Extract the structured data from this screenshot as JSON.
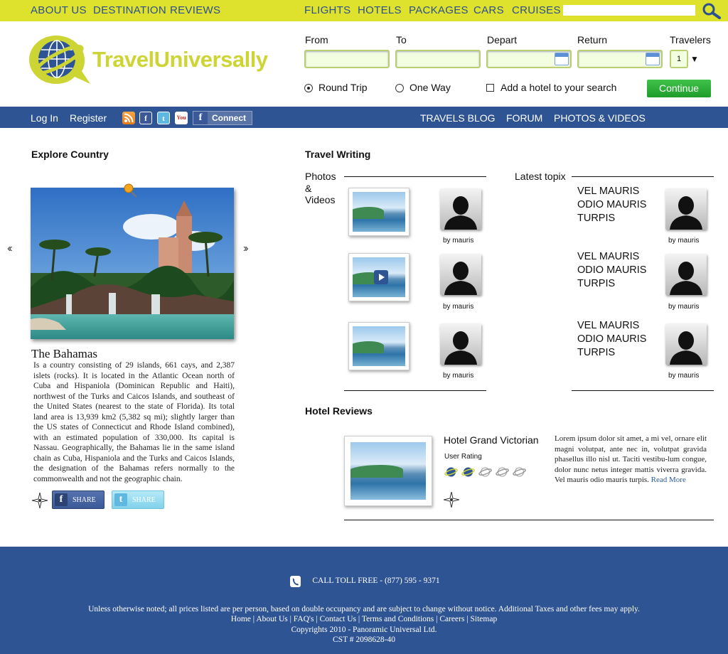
{
  "top_nav": {
    "about": "ABOUT US",
    "destination": "DESTINATION",
    "reviews": "REVIEWS",
    "flights": "FLIGHTS",
    "hotels": "HOTELS",
    "packages": "PACKAGES",
    "cars": "CARS",
    "cruises": "CRUISES",
    "search_value": "",
    "search_icon": "search-icon"
  },
  "logo": {
    "text": "TravelUniversally"
  },
  "booking": {
    "from_label": "From",
    "to_label": "To",
    "depart_label": "Depart",
    "return_label": "Return",
    "travelers_label": "Travelers",
    "travelers_value": "1",
    "round_trip_label": "Round Trip",
    "one_way_label": "One Way",
    "hotel_label": "Add a hotel to your search",
    "continue_label": "Continue",
    "trip_type": "Round Trip"
  },
  "user_nav": {
    "login": "Log In",
    "register": "Register",
    "connect": "Connect",
    "social_icons": [
      "rss-icon",
      "facebook-icon",
      "twitter-icon",
      "youtube-icon"
    ],
    "blog": "TRAVELS BLOG",
    "forum": "FORUM",
    "photos_videos": "PHOTOS & VIDEOS"
  },
  "explore": {
    "heading": "Explore Country",
    "prev": "‹‹",
    "next": "››",
    "country_name": "The Bahamas",
    "description": "Is a country consisting of 29 islands, 661 cays, and 2,387 islets (rocks). It is located in the Atlantic Ocean north of Cuba and Hispaniola (Dominican Republic and Haiti), northwest of the Turks and Caicos Islands, and southeast of the United States (nearest to the state of Florida). Its total land area is 13,939 km2 (5,382 sq mi); slightly larger than the US states of Connecticut and Rhode Island combined), with an estimated population of 330,000. Its capital is Nassau. Geographically, the Bahamas lie in the same island chain as Cuba, Hispaniola and the Turks and Caicos Islands, the designation of the Bahamas refers normally to the commonwealth and not the geographic chain.",
    "share_fb": "SHARE",
    "share_tw": "SHARE"
  },
  "travel_writing": {
    "heading": "Travel Writing",
    "photos_label_1": "Photos",
    "photos_label_2": "&",
    "photos_label_3": "Videos",
    "latest_label": "Latest topix",
    "media_items": [
      {
        "byline": "by mauris",
        "is_video": false
      },
      {
        "byline": "by mauris",
        "is_video": true
      },
      {
        "byline": "by mauris",
        "is_video": false
      }
    ],
    "topics": [
      {
        "title": "VEL MAURIS ODIO MAURIS TURPIS",
        "byline": "by mauris"
      },
      {
        "title": "VEL MAURIS ODIO MAURIS TURPIS",
        "byline": "by mauris"
      },
      {
        "title": "VEL MAURIS ODIO MAURIS TURPIS",
        "byline": "by mauris"
      }
    ]
  },
  "hotel_reviews": {
    "heading": "Hotel Reviews",
    "hotel_name": "Hotel Grand Victorian",
    "rating_label": "User Rating",
    "rating": 2,
    "rating_max": 5,
    "description": "Lorem ipsum dolor sit amet, a mi vel, ornare elit magni volutpat, ante nec in, volutpat gravida phasellus illo nisl ut. Taciti vestibu-lum congue, dolor nunc netus integer mattis viverra gravida. Vel mauris odio mauris turpis.",
    "read_more": "Read More"
  },
  "footer": {
    "phone": "CALL TOLL FREE - (877) 595 - 9371",
    "notice": "Unless otherwise noted; all prices listed are per person, based on double occupancy and are subject to change without notice. Additional Taxes and other fees may apply.",
    "links": [
      "Home",
      "About Us",
      "FAQ's",
      "Contact Us",
      "Terms and Conditions",
      "Careers",
      "Sitemap"
    ],
    "copyright": "Copyrights 2010 - Panoramic Universal Ltd.",
    "cst": "CST # 2098628-40"
  },
  "colors": {
    "top_bar": "#dfe22c",
    "blue_bar": "#2f5494",
    "logo_green": "#cdd534",
    "continue_green": "#1e9c2a"
  }
}
